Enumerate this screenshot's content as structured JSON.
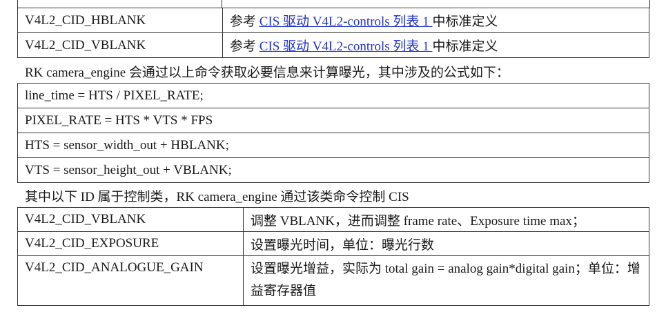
{
  "table1": {
    "rows": [
      {
        "name": "V4L2_CID_HBLANK",
        "prefix": "参考 ",
        "link": "CIS 驱动 V4L2-controls 列表 1 ",
        "suffix": "中标准定义"
      },
      {
        "name": "V4L2_CID_VBLANK",
        "prefix": "参考 ",
        "link": "CIS 驱动 V4L2-controls 列表 1 ",
        "suffix": "中标准定义"
      }
    ]
  },
  "para1": "RK camera_engine 会通过以上命令获取必要信息来计算曝光，其中涉及的公式如下：",
  "formulas": [
    "line_time = HTS / PIXEL_RATE;",
    "PIXEL_RATE = HTS * VTS * FPS",
    "HTS = sensor_width_out + HBLANK;",
    "VTS = sensor_height_out + VBLANK;"
  ],
  "para2": "其中以下 ID 属于控制类，RK camera_engine 通过该类命令控制 CIS",
  "table2": {
    "rows": [
      {
        "name": "V4L2_CID_VBLANK",
        "desc": "调整 VBLANK，进而调整 frame rate、Exposure time max；"
      },
      {
        "name": "V4L2_CID_EXPOSURE",
        "desc": "设置曝光时间，单位：曝光行数"
      },
      {
        "name": "V4L2_CID_ANALOGUE_GAIN",
        "desc": "设置曝光增益，实际为 total gain = analog gain*digital gain；单位：增益寄存器值"
      }
    ]
  }
}
